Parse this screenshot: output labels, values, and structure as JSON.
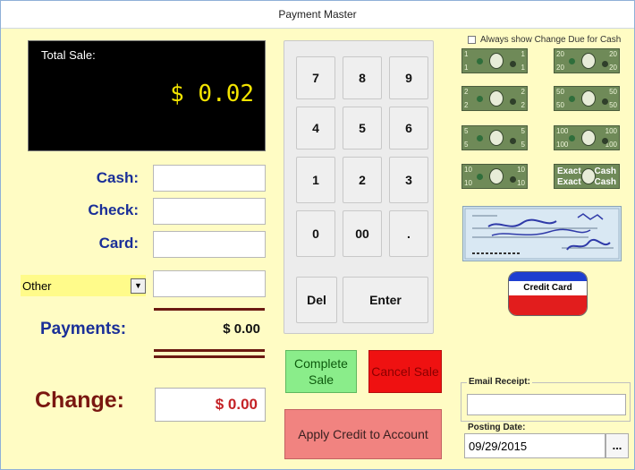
{
  "window": {
    "title": "Payment Master"
  },
  "total_sale": {
    "label": "Total Sale:",
    "value": "$ 0.02"
  },
  "payment_fields": {
    "cash_label": "Cash:",
    "check_label": "Check:",
    "card_label": "Card:",
    "cash_value": "",
    "check_value": "",
    "card_value": "",
    "other_value": "",
    "other_type": "Other"
  },
  "payments": {
    "label": "Payments:",
    "value": "$ 0.00"
  },
  "change": {
    "label": "Change:",
    "value": "$ 0.00"
  },
  "keypad": {
    "keys": [
      "7",
      "8",
      "9",
      "4",
      "5",
      "6",
      "1",
      "2",
      "3",
      "0",
      "00",
      "."
    ],
    "del_label": "Del",
    "enter_label": "Enter"
  },
  "actions": {
    "complete_sale": "Complete Sale",
    "cancel_sale": "Cancel Sale",
    "apply_credit": "Apply Credit to Account"
  },
  "change_due_option": {
    "label": "Always show Change Due for Cash",
    "checked": false
  },
  "cash_bills": [
    {
      "value": "1"
    },
    {
      "value": "20"
    },
    {
      "value": "2"
    },
    {
      "value": "50"
    },
    {
      "value": "5"
    },
    {
      "value": "100"
    },
    {
      "value": "10"
    },
    {
      "left": "Exact",
      "right": "Cash"
    }
  ],
  "credit_card": {
    "label": "Credit Card"
  },
  "email_receipt": {
    "label": "Email Receipt:",
    "value": ""
  },
  "posting_date": {
    "label": "Posting Date:",
    "value": "09/29/2015",
    "picker_label": "..."
  },
  "colors": {
    "background": "#fffcc4",
    "label_blue": "#1a2f98",
    "change_red": "#7a1710",
    "total_yellow": "#f3e400",
    "complete_green": "#8aed8a",
    "cancel_red": "#ef1111",
    "apply_pink": "#f18380"
  }
}
